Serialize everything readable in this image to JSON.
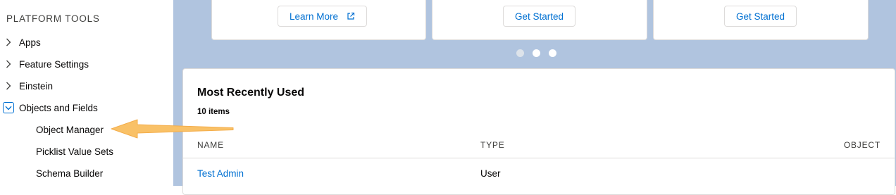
{
  "sidebar": {
    "section_title": "PLATFORM TOOLS",
    "items": [
      {
        "label": "Apps"
      },
      {
        "label": "Feature Settings"
      },
      {
        "label": "Einstein"
      },
      {
        "label": "Objects and Fields"
      }
    ],
    "sub_items": [
      {
        "label": "Object Manager"
      },
      {
        "label": "Picklist Value Sets"
      },
      {
        "label": "Schema Builder"
      }
    ]
  },
  "tiles": [
    {
      "button_label": "Learn More",
      "icon": "external-link-icon"
    },
    {
      "button_label": "Get Started"
    },
    {
      "button_label": "Get Started"
    }
  ],
  "carousel": {
    "dots": 3,
    "active_index": 0
  },
  "recent": {
    "title": "Most Recently Used",
    "count": "10 items",
    "columns": [
      "NAME",
      "TYPE",
      "OBJECT"
    ],
    "rows": [
      {
        "name": "Test Admin",
        "type": "User",
        "object": ""
      }
    ]
  },
  "colors": {
    "accent": "#0070d2",
    "banner_background": "#b0c4df",
    "arrow": "#f9c167"
  }
}
